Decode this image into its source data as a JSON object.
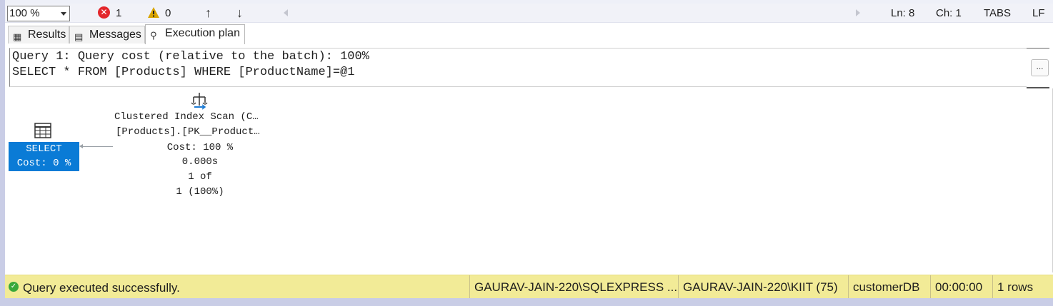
{
  "toolbar": {
    "zoom": "100 %",
    "errors": "1",
    "warnings": "0",
    "status": {
      "line": "Ln: 8",
      "col": "Ch: 1",
      "indent": "TABS",
      "eol": "LF"
    }
  },
  "tabs": [
    {
      "label": "Results",
      "icon": "grid-icon"
    },
    {
      "label": "Messages",
      "icon": "messages-icon"
    },
    {
      "label": "Execution plan",
      "icon": "execution-plan-icon",
      "active": true
    }
  ],
  "query": {
    "line1": "Query 1: Query cost (relative to the batch): 100%",
    "line2": "SELECT * FROM [Products] WHERE [ProductName]=@1",
    "more_button": "..."
  },
  "plan": {
    "select_node": {
      "label": "SELECT",
      "cost": "Cost: 0 %"
    },
    "scan_node": {
      "title": "Clustered Index Scan (C…",
      "object": "[Products].[PK__Product…",
      "cost": "Cost: 100 %",
      "time": "0.000s",
      "rows_line1": "1 of",
      "rows_line2": "1 (100%)"
    }
  },
  "statusbar": {
    "message": "Query executed successfully.",
    "server": "GAURAV-JAIN-220\\SQLEXPRESS ...",
    "user": "GAURAV-JAIN-220\\KIIT (75)",
    "database": "customerDB",
    "elapsed": "00:00:00",
    "rows": "1 rows"
  },
  "colors": {
    "accent": "#0a7bd6",
    "status_bg": "#f2eb97",
    "error": "#e3262b",
    "warning": "#d9a400",
    "success": "#3aa83a"
  }
}
